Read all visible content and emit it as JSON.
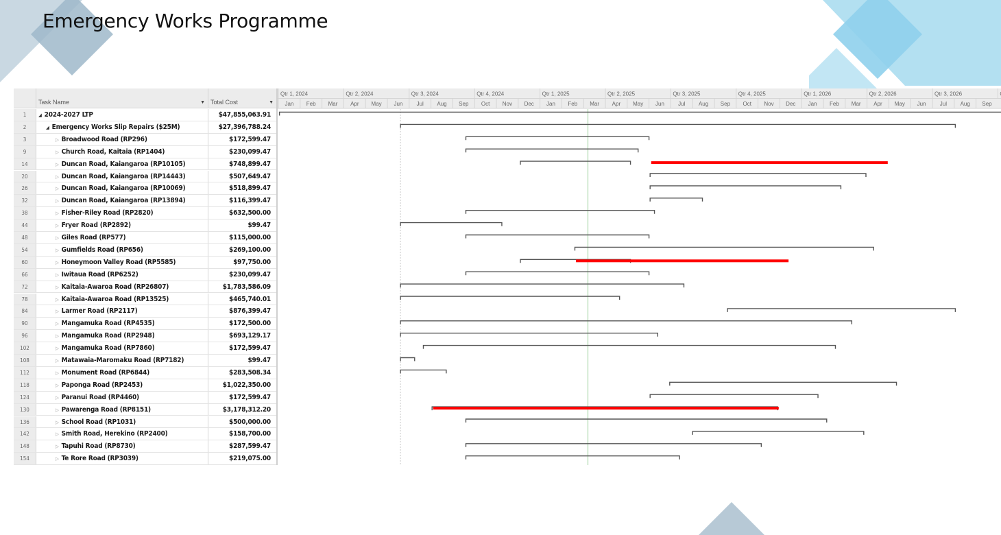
{
  "title": "Emergency Works Programme",
  "colors": {
    "accent_red": "#ff0000",
    "bar_outline": "#555555",
    "status_line": "#9bd19b",
    "deco_light": "#a8dcef",
    "deco_mid": "#7cc7e6",
    "deco_gray": "#b7c9d6"
  },
  "table": {
    "col_task": "Task Name",
    "col_cost": "Total Cost",
    "rows": [
      {
        "id": "1",
        "name": "2024-2027 LTP",
        "cost": "$47,855,063.91",
        "level": 0
      },
      {
        "id": "2",
        "name": "Emergency Works Slip Repairs ($25M)",
        "cost": "$27,396,788.24",
        "level": 1
      },
      {
        "id": "3",
        "name": "Broadwood Road (RP296)",
        "cost": "$172,599.47",
        "level": 2
      },
      {
        "id": "9",
        "name": "Church Road, Kaitaia (RP1404)",
        "cost": "$230,099.47",
        "level": 2
      },
      {
        "id": "14",
        "name": "Duncan Road, Kaiangaroa (RP10105)",
        "cost": "$748,899.47",
        "level": 2
      },
      {
        "id": "20",
        "name": "Duncan Road, Kaiangaroa (RP14443)",
        "cost": "$507,649.47",
        "level": 2
      },
      {
        "id": "26",
        "name": "Duncan Road, Kaiangaroa (RP10069)",
        "cost": "$518,899.47",
        "level": 2
      },
      {
        "id": "32",
        "name": "Duncan Road, Kaiangaroa (RP13894)",
        "cost": "$116,399.47",
        "level": 2
      },
      {
        "id": "38",
        "name": "Fisher-Riley Road (RP2820)",
        "cost": "$632,500.00",
        "level": 2
      },
      {
        "id": "44",
        "name": "Fryer Road (RP2892)",
        "cost": "$99.47",
        "level": 2
      },
      {
        "id": "48",
        "name": "Giles Road (RP577)",
        "cost": "$115,000.00",
        "level": 2
      },
      {
        "id": "54",
        "name": "Gumfields Road (RP656)",
        "cost": "$269,100.00",
        "level": 2
      },
      {
        "id": "60",
        "name": "Honeymoon Valley Road (RP5585)",
        "cost": "$97,750.00",
        "level": 2
      },
      {
        "id": "66",
        "name": "Iwitaua Road (RP6252)",
        "cost": "$230,099.47",
        "level": 2
      },
      {
        "id": "72",
        "name": "Kaitaia-Awaroa Road (RP26807)",
        "cost": "$1,783,586.09",
        "level": 2
      },
      {
        "id": "78",
        "name": "Kaitaia-Awaroa Road (RP13525)",
        "cost": "$465,740.01",
        "level": 2
      },
      {
        "id": "84",
        "name": "Larmer Road (RP2117)",
        "cost": "$876,399.47",
        "level": 2
      },
      {
        "id": "90",
        "name": "Mangamuka Road (RP4535)",
        "cost": "$172,500.00",
        "level": 2
      },
      {
        "id": "96",
        "name": "Mangamuka Road (RP2948)",
        "cost": "$693,129.17",
        "level": 2
      },
      {
        "id": "102",
        "name": "Mangamuka Road (RP7860)",
        "cost": "$172,599.47",
        "level": 2
      },
      {
        "id": "108",
        "name": "Matawaia-Maromaku Road (RP7182)",
        "cost": "$99.47",
        "level": 2
      },
      {
        "id": "112",
        "name": "Monument Road (RP6844)",
        "cost": "$283,508.34",
        "level": 2
      },
      {
        "id": "118",
        "name": "Paponga Road (RP2453)",
        "cost": "$1,022,350.00",
        "level": 2
      },
      {
        "id": "124",
        "name": "Paranui Road (RP4460)",
        "cost": "$172,599.47",
        "level": 2
      },
      {
        "id": "130",
        "name": "Pawarenga Road (RP8151)",
        "cost": "$3,178,312.20",
        "level": 2
      },
      {
        "id": "136",
        "name": "School Road (RP1031)",
        "cost": "$500,000.00",
        "level": 2
      },
      {
        "id": "142",
        "name": "Smith Road, Herekino (RP2400)",
        "cost": "$158,700.00",
        "level": 2
      },
      {
        "id": "148",
        "name": "Tapuhi Road (RP8730)",
        "cost": "$287,599.47",
        "level": 2
      },
      {
        "id": "154",
        "name": "Te Rore Road (RP3039)",
        "cost": "$219,075.00",
        "level": 2
      }
    ]
  },
  "timescale": {
    "quarters": [
      "Qtr 1, 2024",
      "Qtr 2, 2024",
      "Qtr 3, 2024",
      "Qtr 4, 2024",
      "Qtr 1, 2025",
      "Qtr 2, 2025",
      "Qtr 3, 2025",
      "Qtr 4, 2025",
      "Qtr 1, 2026",
      "Qtr 2, 2026",
      "Qtr 3, 2026",
      "Q"
    ],
    "months": [
      "Jan",
      "Feb",
      "Mar",
      "Apr",
      "May",
      "Jun",
      "Jul",
      "Aug",
      "Sep",
      "Oct",
      "Nov",
      "Dec",
      "Jan",
      "Feb",
      "Mar",
      "Apr",
      "May",
      "Jun",
      "Jul",
      "Aug",
      "Sep",
      "Oct",
      "Nov",
      "Dec",
      "Jan",
      "Feb",
      "Mar",
      "Apr",
      "May",
      "Jun",
      "Jul",
      "Aug",
      "Sep"
    ]
  },
  "gantt": {
    "status_date": "Mar 2025",
    "summary_bars": [
      {
        "row": 0,
        "start": 0.05,
        "end": 33.3
      },
      {
        "row": 1,
        "start": 5.6,
        "end": 31.05
      },
      {
        "row": 2,
        "start": 8.6,
        "end": 17.0
      },
      {
        "row": 3,
        "start": 8.6,
        "end": 16.5
      },
      {
        "row": 4,
        "start": 11.1,
        "end": 16.15
      },
      {
        "row": 5,
        "start": 17.05,
        "end": 26.95
      },
      {
        "row": 6,
        "start": 17.05,
        "end": 25.8
      },
      {
        "row": 7,
        "start": 17.05,
        "end": 19.45
      },
      {
        "row": 8,
        "start": 8.6,
        "end": 17.25
      },
      {
        "row": 9,
        "start": 5.6,
        "end": 10.25
      },
      {
        "row": 10,
        "start": 8.6,
        "end": 17.0
      },
      {
        "row": 11,
        "start": 13.6,
        "end": 27.3
      },
      {
        "row": 12,
        "start": 11.1,
        "end": 16.15
      },
      {
        "row": 13,
        "start": 8.6,
        "end": 17.0
      },
      {
        "row": 14,
        "start": 5.6,
        "end": 18.6
      },
      {
        "row": 15,
        "start": 5.6,
        "end": 15.65
      },
      {
        "row": 16,
        "start": 20.6,
        "end": 31.05
      },
      {
        "row": 17,
        "start": 5.6,
        "end": 26.3
      },
      {
        "row": 18,
        "start": 5.6,
        "end": 17.4
      },
      {
        "row": 19,
        "start": 6.65,
        "end": 25.55
      },
      {
        "row": 20,
        "start": 5.6,
        "end": 6.25
      },
      {
        "row": 21,
        "start": 5.6,
        "end": 7.7
      },
      {
        "row": 22,
        "start": 17.95,
        "end": 28.35
      },
      {
        "row": 23,
        "start": 17.05,
        "end": 24.75
      },
      {
        "row": 24,
        "start": 7.05,
        "end": 22.9
      },
      {
        "row": 25,
        "start": 8.6,
        "end": 25.15
      },
      {
        "row": 26,
        "start": 19.0,
        "end": 26.85
      },
      {
        "row": 27,
        "start": 8.6,
        "end": 22.15
      },
      {
        "row": 28,
        "start": 8.6,
        "end": 18.4
      }
    ],
    "critical_bars": [
      {
        "row": 4,
        "start": 17.1,
        "end": 27.95
      },
      {
        "row": 12,
        "start": 13.65,
        "end": 23.4
      },
      {
        "row": 24,
        "start": 7.1,
        "end": 22.95
      }
    ]
  }
}
